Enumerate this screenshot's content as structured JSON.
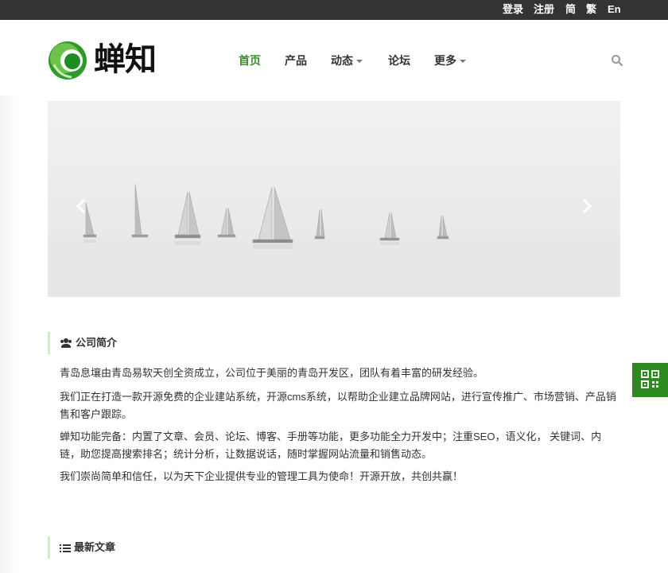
{
  "topbar": {
    "login": "登录",
    "register": "注册",
    "simplified": "简",
    "traditional": "繁",
    "english": "En"
  },
  "brand": {
    "name": "蝉知",
    "accent_color": "#3a8b2a"
  },
  "nav": {
    "items": [
      {
        "label": "首页",
        "active": true,
        "dropdown": false
      },
      {
        "label": "产品",
        "active": false,
        "dropdown": false
      },
      {
        "label": "动态",
        "active": false,
        "dropdown": true
      },
      {
        "label": "论坛",
        "active": false,
        "dropdown": false
      },
      {
        "label": "更多",
        "active": false,
        "dropdown": true
      }
    ],
    "search_icon": "search-icon"
  },
  "banner": {
    "image": "sailboats-on-misty-sea",
    "prev_icon": "chevron-left-icon",
    "next_icon": "chevron-right-icon"
  },
  "intro": {
    "icon": "users-icon",
    "title": "公司简介",
    "paragraphs": [
      "青岛息壤由青岛易软天创全资成立，公司位于美丽的青岛开发区，团队有着丰富的研发经验。",
      "我们正在打造一款开源免费的企业建站系统，开源cms系统，以帮助企业建立品牌网站，进行宣传推广、市场营销、产品销售和客户跟踪。",
      "蝉知功能完备：内置了文章、会员、论坛、博客、手册等功能，更多功能全力开发中；注重SEO，语义化， 关键词、内链，助您提高搜索排名；统计分析，让数据说话，随时掌握网站流量和销售动态。",
      "我们崇尚简单和信任，以为天下企业提供专业的管理工具为使命！开源开放，共创共赢！"
    ]
  },
  "latest": {
    "icon": "list-icon",
    "title": "最新文章"
  },
  "side_widget": {
    "icon": "qrcode-icon",
    "color": "#2d8a1e"
  }
}
